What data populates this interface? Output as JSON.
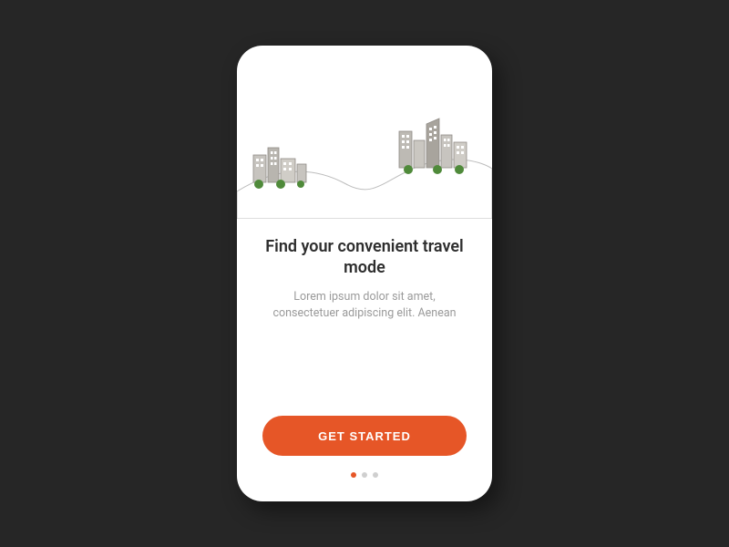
{
  "colors": {
    "accent": "#e65627",
    "background": "#262626",
    "card": "#ffffff",
    "text_primary": "#2d2d2d",
    "text_secondary": "#9a9a9a",
    "dot_inactive": "#cfcfcf"
  },
  "illustration": {
    "name": "cityscape-hills"
  },
  "onboarding": {
    "title": "Find your convenient travel mode",
    "subtitle": "Lorem ipsum dolor sit amet, consectetuer adipiscing elit. Aenean",
    "cta_label": "GET STARTED",
    "page_count": 3,
    "active_page_index": 0
  }
}
